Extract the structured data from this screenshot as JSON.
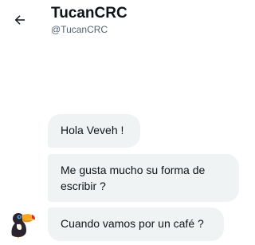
{
  "header": {
    "title": "TucanCRC",
    "handle": "@TucanCRC",
    "back_icon": "arrow-left-icon"
  },
  "messages": [
    {
      "text": "Hola Veveh !"
    },
    {
      "text": "Me gusta mucho su forma de escribir ?"
    },
    {
      "text": "Cuando vamos por un café ?"
    }
  ],
  "avatar": {
    "icon": "toucan-avatar"
  },
  "colors": {
    "bubble_bg": "#eff3f4",
    "text_primary": "#0f1419",
    "text_secondary": "#536471",
    "toucan_body": "#2b2430",
    "toucan_beak": "#f5a623",
    "toucan_beak_accent": "#d0312d"
  }
}
